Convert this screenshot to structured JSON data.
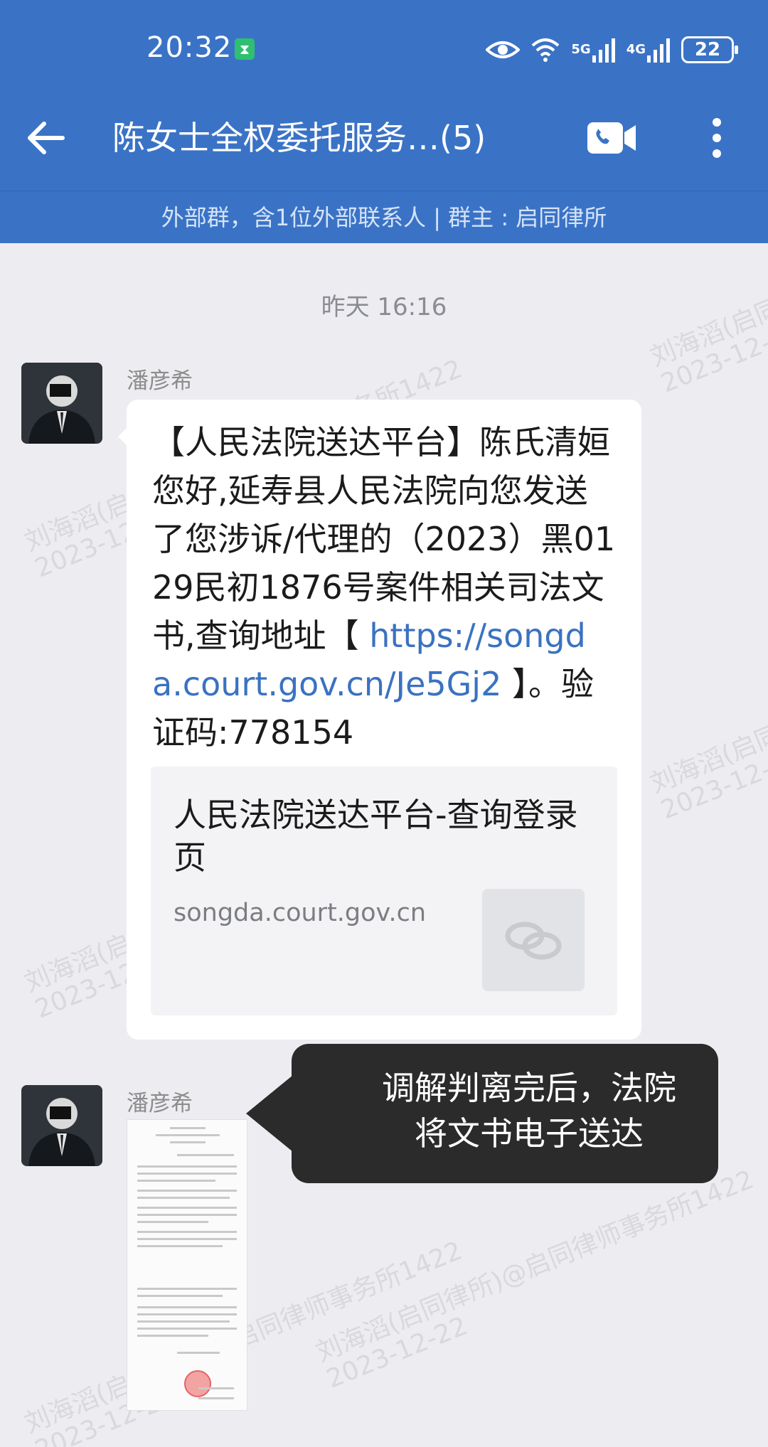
{
  "status_bar": {
    "time": "20:32",
    "sim_glyph": "⧗",
    "signal_1_label": "5G",
    "signal_2_label": "4G",
    "battery": "22",
    "icons": [
      "eye-icon",
      "wifi-icon",
      "signal-5g-icon",
      "signal-4g-icon",
      "battery-icon"
    ]
  },
  "nav": {
    "title": "陈女士全权委托服务…(5)",
    "icons": [
      "back-arrow-icon",
      "video-call-icon",
      "more-vertical-icon"
    ]
  },
  "subheader": {
    "text": "外部群，含1位外部联系人 | 群主 : 启同律所"
  },
  "chat": {
    "timestamp": "昨天  16:16",
    "messages": [
      {
        "sender": "潘彦希",
        "text_before_link": "【人民法院送达平台】陈氏清姮您好,延寿县人民法院向您发送了您涉诉/代理的（2023）黑0129民初1876号案件相关司法文书,查询地址【 ",
        "link": "https://songda.court.gov.cn/Je5Gj2",
        "text_after_link": " 】。验证码:778154",
        "card": {
          "title": "人民法院送达平台-查询登录页",
          "domain": "songda.court.gov.cn",
          "thumb_icon": "link-chain-icon"
        }
      },
      {
        "sender": "潘彦希",
        "attachment": "document-image"
      }
    ]
  },
  "annotation": {
    "text": "调解判离完后，法院将文书电子送达"
  },
  "watermarks": {
    "line1": "刘海滔(启同律所)@启同律师事务所1422",
    "line2": "2023-12-22"
  },
  "colors": {
    "header_bg": "#3a73c6",
    "chat_bg": "#ededf1",
    "link": "#3a72c0",
    "tooltip_bg": "#2b2b2b"
  }
}
